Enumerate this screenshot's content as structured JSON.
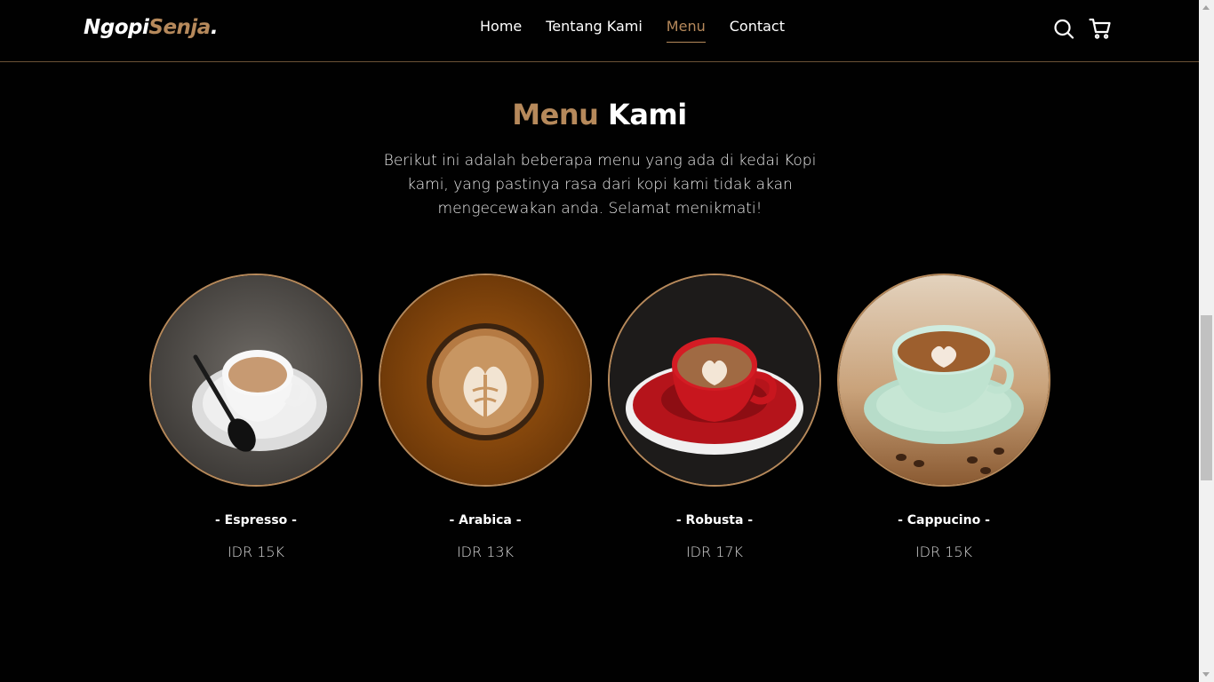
{
  "navbar": {
    "logo_main": "Ngopi",
    "logo_accent": "Senja",
    "logo_dot": ".",
    "links": [
      {
        "label": "Home"
      },
      {
        "label": "Tentang Kami"
      },
      {
        "label": "Menu"
      },
      {
        "label": "Contact"
      }
    ],
    "active_link": "Menu",
    "icons": [
      "search-icon",
      "shopping-cart-icon"
    ]
  },
  "menu_section": {
    "title_accent": "Menu",
    "title_main": " Kami",
    "description": "Berikut ini adalah beberapa menu yang ada di kedai Kopi kami, yang pastinya rasa dari kopi kami tidak akan mengecewakan anda. Selamat menikmati!",
    "items": [
      {
        "name": "- Espresso -",
        "price": "IDR 15K"
      },
      {
        "name": "- Arabica -",
        "price": "IDR 13K"
      },
      {
        "name": "- Robusta -",
        "price": "IDR 17K"
      },
      {
        "name": "- Cappucino -",
        "price": "IDR 15K"
      }
    ]
  },
  "colors": {
    "background": "#010101",
    "accent": "#b6895b",
    "text": "#ffffff"
  }
}
